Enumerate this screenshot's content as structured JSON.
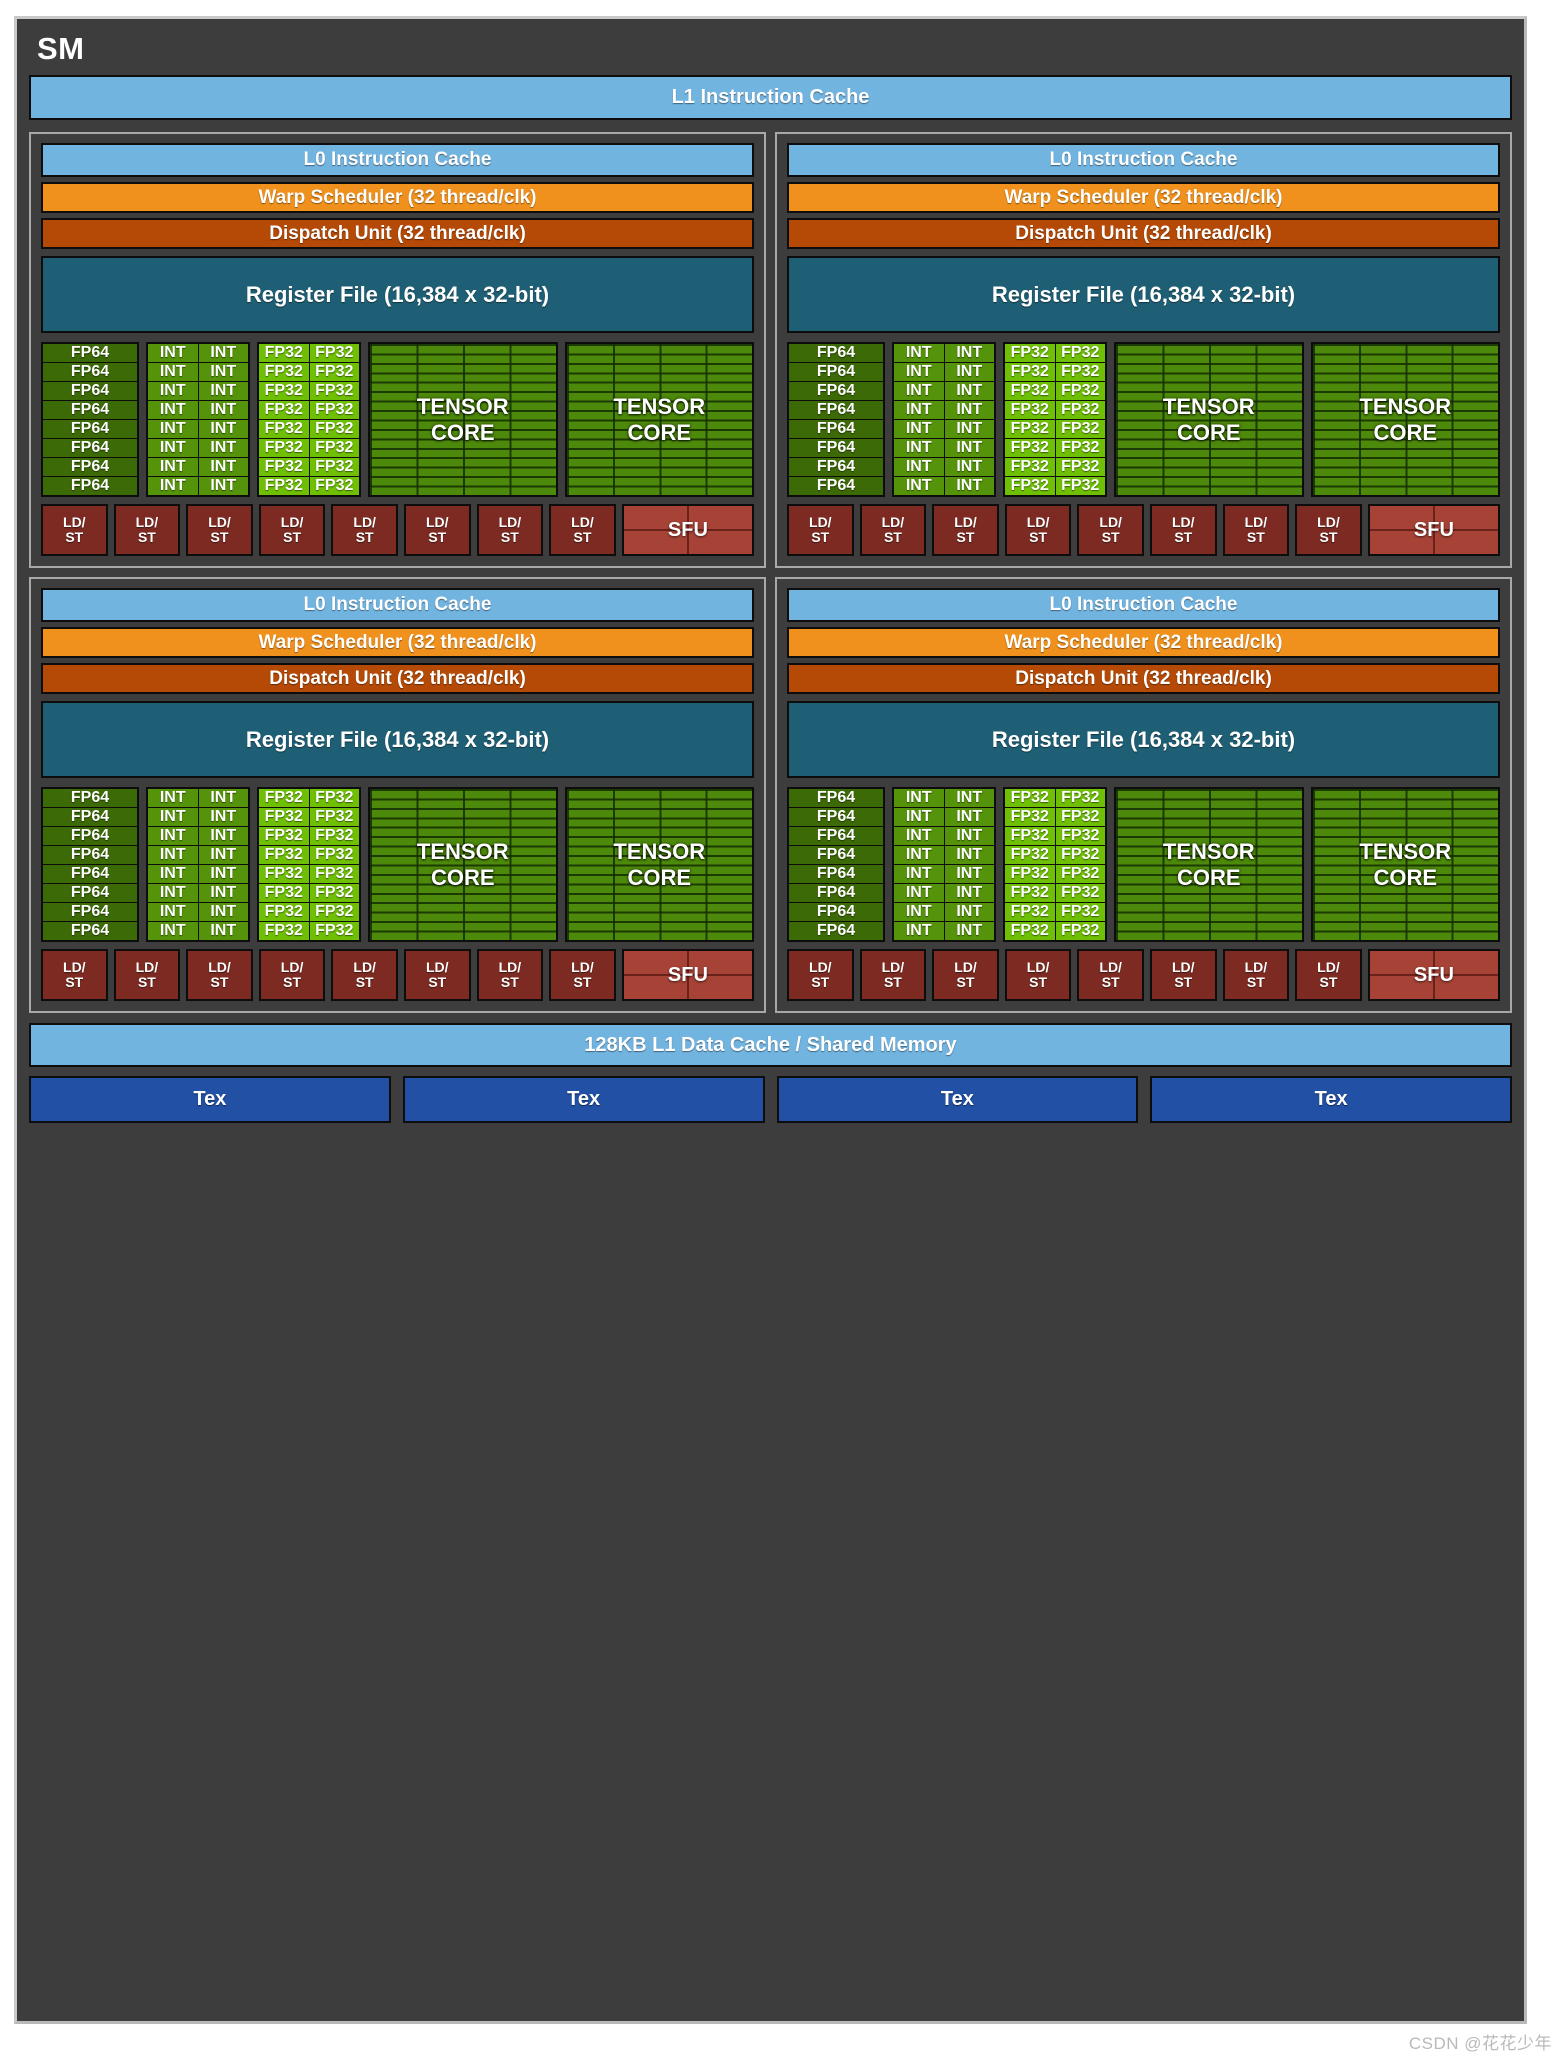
{
  "diagram": {
    "title": "SM",
    "l1_instruction_cache": "L1 Instruction Cache",
    "l1_data_cache": "128KB L1 Data Cache / Shared Memory",
    "watermark": "CSDN @花花少年",
    "colors": {
      "background": "#3d3d3d",
      "outer_border": "#b9b9b9",
      "cache_blue": "#72b4e0",
      "warp_scheduler_orange": "#f0911d",
      "dispatch_unit_brown": "#b44a06",
      "register_file_teal": "#1f5f75",
      "fp64_green": "#3c6a06",
      "int_green": "#55930a",
      "fp32_green": "#6fc005",
      "tensor_core_green": "#4d8a0b",
      "ldst_dark_red": "#7d2b22",
      "sfu_red": "#a64236",
      "tex_blue": "#2250a5"
    }
  },
  "processing_blocks": [
    {
      "id": "block-0",
      "l0_instruction_cache": "L0 Instruction Cache",
      "warp_scheduler": "Warp Scheduler (32 thread/clk)",
      "dispatch_unit": "Dispatch Unit (32 thread/clk)",
      "register_file": "Register File (16,384 x 32-bit)",
      "fp64_label": "FP64",
      "fp64_count": 8,
      "int_label": "INT",
      "int_count": 16,
      "fp32_label": "FP32",
      "fp32_count": 16,
      "tensor_core_label": "TENSOR\nCORE",
      "tensor_core_line1": "TENSOR",
      "tensor_core_line2": "CORE",
      "tensor_core_count": 2,
      "ldst_label_line1": "LD/",
      "ldst_label_line2": "ST",
      "ldst_count": 8,
      "sfu_label": "SFU",
      "sfu_count": 1
    },
    {
      "id": "block-1",
      "l0_instruction_cache": "L0 Instruction Cache",
      "warp_scheduler": "Warp Scheduler (32 thread/clk)",
      "dispatch_unit": "Dispatch Unit (32 thread/clk)",
      "register_file": "Register File (16,384 x 32-bit)",
      "fp64_label": "FP64",
      "fp64_count": 8,
      "int_label": "INT",
      "int_count": 16,
      "fp32_label": "FP32",
      "fp32_count": 16,
      "tensor_core_line1": "TENSOR",
      "tensor_core_line2": "CORE",
      "tensor_core_count": 2,
      "ldst_label_line1": "LD/",
      "ldst_label_line2": "ST",
      "ldst_count": 8,
      "sfu_label": "SFU",
      "sfu_count": 1
    },
    {
      "id": "block-2",
      "l0_instruction_cache": "L0 Instruction Cache",
      "warp_scheduler": "Warp Scheduler (32 thread/clk)",
      "dispatch_unit": "Dispatch Unit (32 thread/clk)",
      "register_file": "Register File (16,384 x 32-bit)",
      "fp64_label": "FP64",
      "fp64_count": 8,
      "int_label": "INT",
      "int_count": 16,
      "fp32_label": "FP32",
      "fp32_count": 16,
      "tensor_core_line1": "TENSOR",
      "tensor_core_line2": "CORE",
      "tensor_core_count": 2,
      "ldst_label_line1": "LD/",
      "ldst_label_line2": "ST",
      "ldst_count": 8,
      "sfu_label": "SFU",
      "sfu_count": 1
    },
    {
      "id": "block-3",
      "l0_instruction_cache": "L0 Instruction Cache",
      "warp_scheduler": "Warp Scheduler (32 thread/clk)",
      "dispatch_unit": "Dispatch Unit (32 thread/clk)",
      "register_file": "Register File (16,384 x 32-bit)",
      "fp64_label": "FP64",
      "fp64_count": 8,
      "int_label": "INT",
      "int_count": 16,
      "fp32_label": "FP32",
      "fp32_count": 16,
      "tensor_core_line1": "TENSOR",
      "tensor_core_line2": "CORE",
      "tensor_core_count": 2,
      "ldst_label_line1": "LD/",
      "ldst_label_line2": "ST",
      "ldst_count": 8,
      "sfu_label": "SFU",
      "sfu_count": 1
    }
  ],
  "tex_units": [
    {
      "label": "Tex"
    },
    {
      "label": "Tex"
    },
    {
      "label": "Tex"
    },
    {
      "label": "Tex"
    }
  ]
}
